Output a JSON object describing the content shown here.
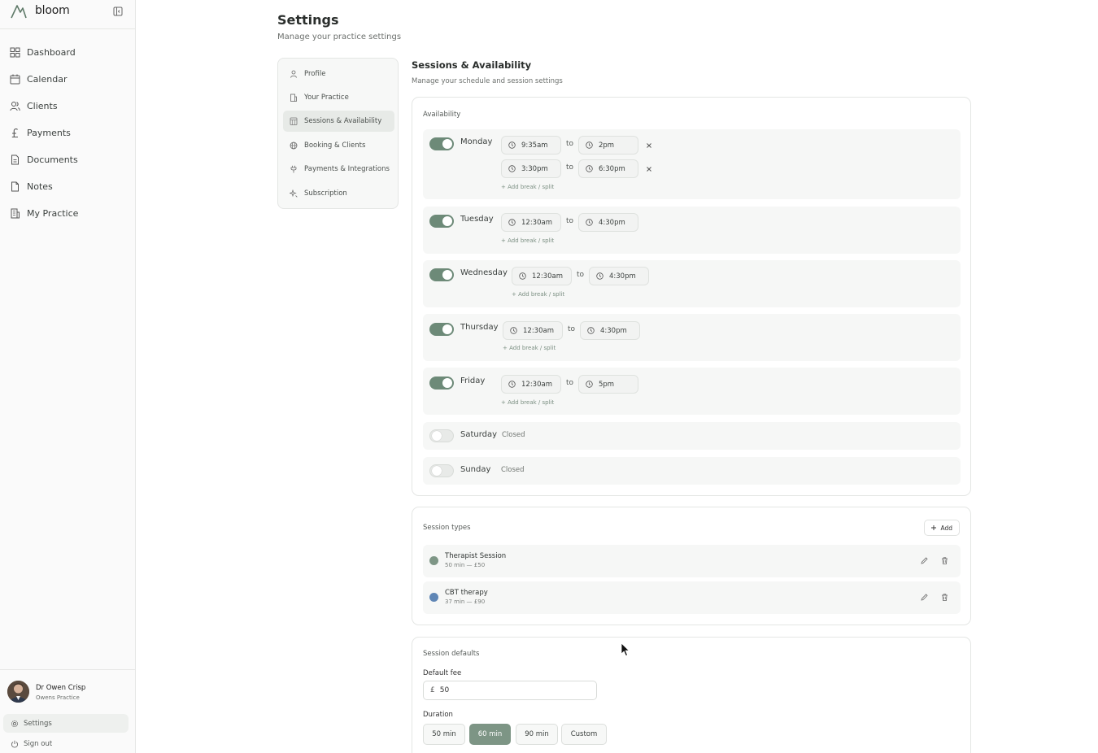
{
  "brand": {
    "name": "bloom"
  },
  "nav": [
    {
      "label": "Dashboard",
      "icon": "dashboard-icon"
    },
    {
      "label": "Calendar",
      "icon": "calendar-icon"
    },
    {
      "label": "Clients",
      "icon": "users-icon"
    },
    {
      "label": "Payments",
      "icon": "pound-icon"
    },
    {
      "label": "Documents",
      "icon": "document-icon"
    },
    {
      "label": "Notes",
      "icon": "note-icon"
    },
    {
      "label": "My Practice",
      "icon": "building-icon"
    }
  ],
  "user": {
    "name": "Dr Owen Crisp",
    "practice": "Owens Practice"
  },
  "sidebar_footer": {
    "settings": "Settings",
    "signout": "Sign out"
  },
  "header": {
    "title": "Settings",
    "subtitle": "Manage your practice settings"
  },
  "submenu": [
    {
      "label": "Profile",
      "active": false
    },
    {
      "label": "Your Practice",
      "active": false
    },
    {
      "label": "Sessions & Availability",
      "active": true
    },
    {
      "label": "Booking & Clients",
      "active": false
    },
    {
      "label": "Payments & Integrations",
      "active": false
    },
    {
      "label": "Subscription",
      "active": false
    }
  ],
  "section": {
    "title": "Sessions & Availability",
    "subtitle": "Manage your schedule and session settings"
  },
  "availability": {
    "label": "Availability",
    "to_label": "to",
    "add_break_label": "+ Add break / split",
    "closed_label": "Closed",
    "days": [
      {
        "name": "Monday",
        "enabled": true,
        "ranges": [
          {
            "start": "9:35am",
            "end": "2pm"
          },
          {
            "start": "3:30pm",
            "end": "6:30pm"
          }
        ]
      },
      {
        "name": "Tuesday",
        "enabled": true,
        "ranges": [
          {
            "start": "12:30am",
            "end": "4:30pm"
          }
        ]
      },
      {
        "name": "Wednesday",
        "enabled": true,
        "ranges": [
          {
            "start": "12:30am",
            "end": "4:30pm"
          }
        ]
      },
      {
        "name": "Thursday",
        "enabled": true,
        "ranges": [
          {
            "start": "12:30am",
            "end": "4:30pm"
          }
        ]
      },
      {
        "name": "Friday",
        "enabled": true,
        "ranges": [
          {
            "start": "12:30am",
            "end": "5pm"
          }
        ]
      },
      {
        "name": "Saturday",
        "enabled": false,
        "ranges": []
      },
      {
        "name": "Sunday",
        "enabled": false,
        "ranges": []
      }
    ]
  },
  "session_types": {
    "label": "Session types",
    "add_label": "Add",
    "items": [
      {
        "name": "Therapist Session",
        "meta": "50 min — £50",
        "color": "#7e9686"
      },
      {
        "name": "CBT therapy",
        "meta": "37 min — £90",
        "color": "#5f86b5"
      }
    ]
  },
  "session_defaults": {
    "label": "Session defaults",
    "fee_label": "Default fee",
    "currency": "£",
    "fee_value": "50",
    "duration_label": "Duration",
    "durations": [
      {
        "label": "50 min",
        "active": false
      },
      {
        "label": "60 min",
        "active": true
      },
      {
        "label": "90 min",
        "active": false
      },
      {
        "label": "Custom",
        "active": false
      }
    ]
  },
  "colors": {
    "accent": "#6d8a78",
    "active_duration": "#7d9585"
  }
}
